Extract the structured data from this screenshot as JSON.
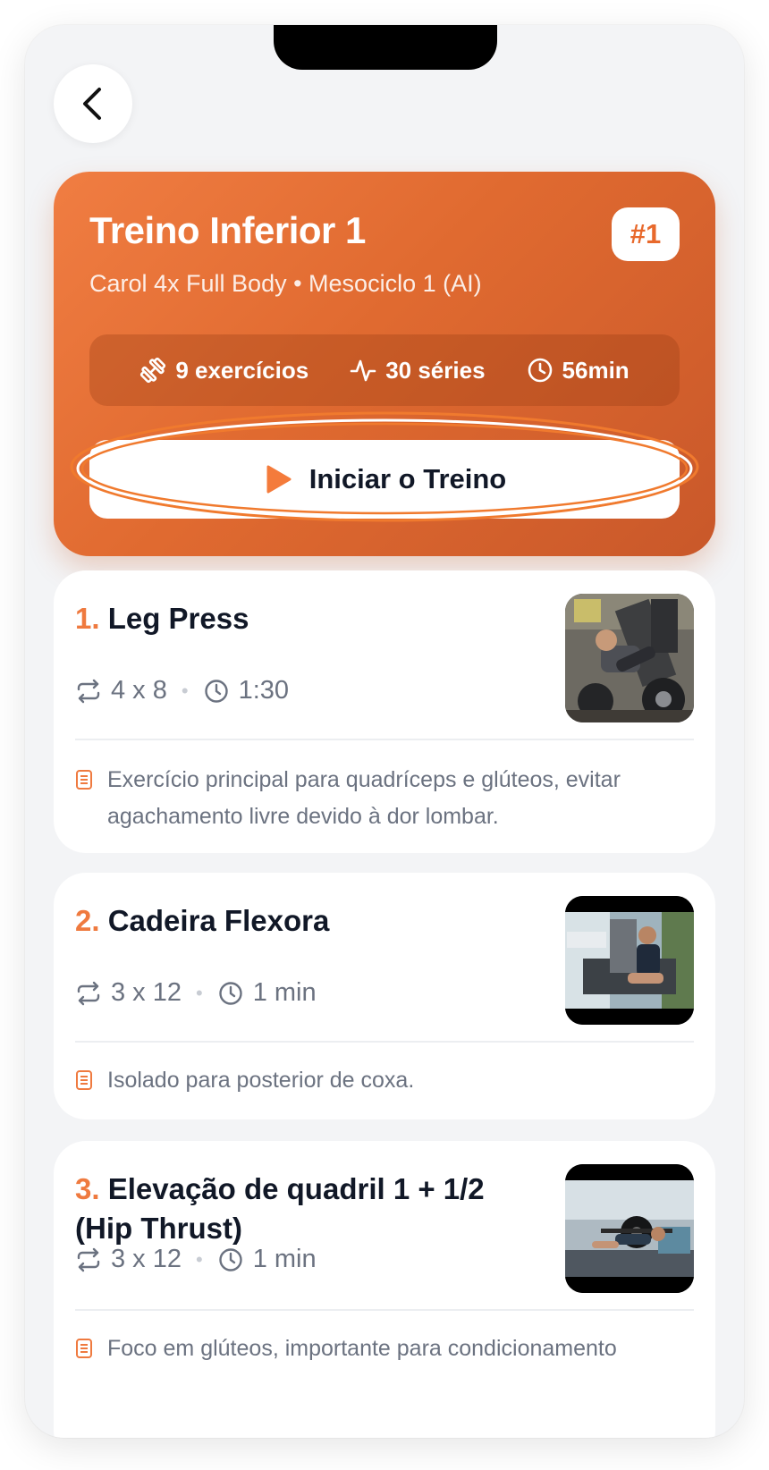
{
  "header": {
    "back_icon": "chevron-left-icon"
  },
  "workout": {
    "title": "Treino Inferior 1",
    "subtitle": "Carol 4x Full Body • Mesociclo 1 (AI)",
    "badge": "#1",
    "stats": {
      "exercises": "9 exercícios",
      "series": "30 séries",
      "duration": "56min"
    },
    "start_label": "Iniciar o Treino"
  },
  "colors": {
    "accent": "#EF7A3F",
    "hero_gradient_start": "#F07D42",
    "hero_gradient_end": "#C9582A",
    "background": "#F3F4F6"
  },
  "exercises": [
    {
      "number": "1.",
      "name": "Leg Press",
      "sets": "4 x 8",
      "rest": "1:30",
      "note": "Exercício principal para quadríceps e glúteos, evitar agachamento livre devido à dor lombar."
    },
    {
      "number": "2.",
      "name": "Cadeira Flexora",
      "sets": "3 x 12",
      "rest": "1 min",
      "note": "Isolado para posterior de coxa."
    },
    {
      "number": "3.",
      "name": "Elevação de quadril 1 + 1/2 (Hip Thrust)",
      "sets": "3 x 12",
      "rest": "1 min",
      "note": "Foco em glúteos, importante para condicionamento"
    }
  ]
}
